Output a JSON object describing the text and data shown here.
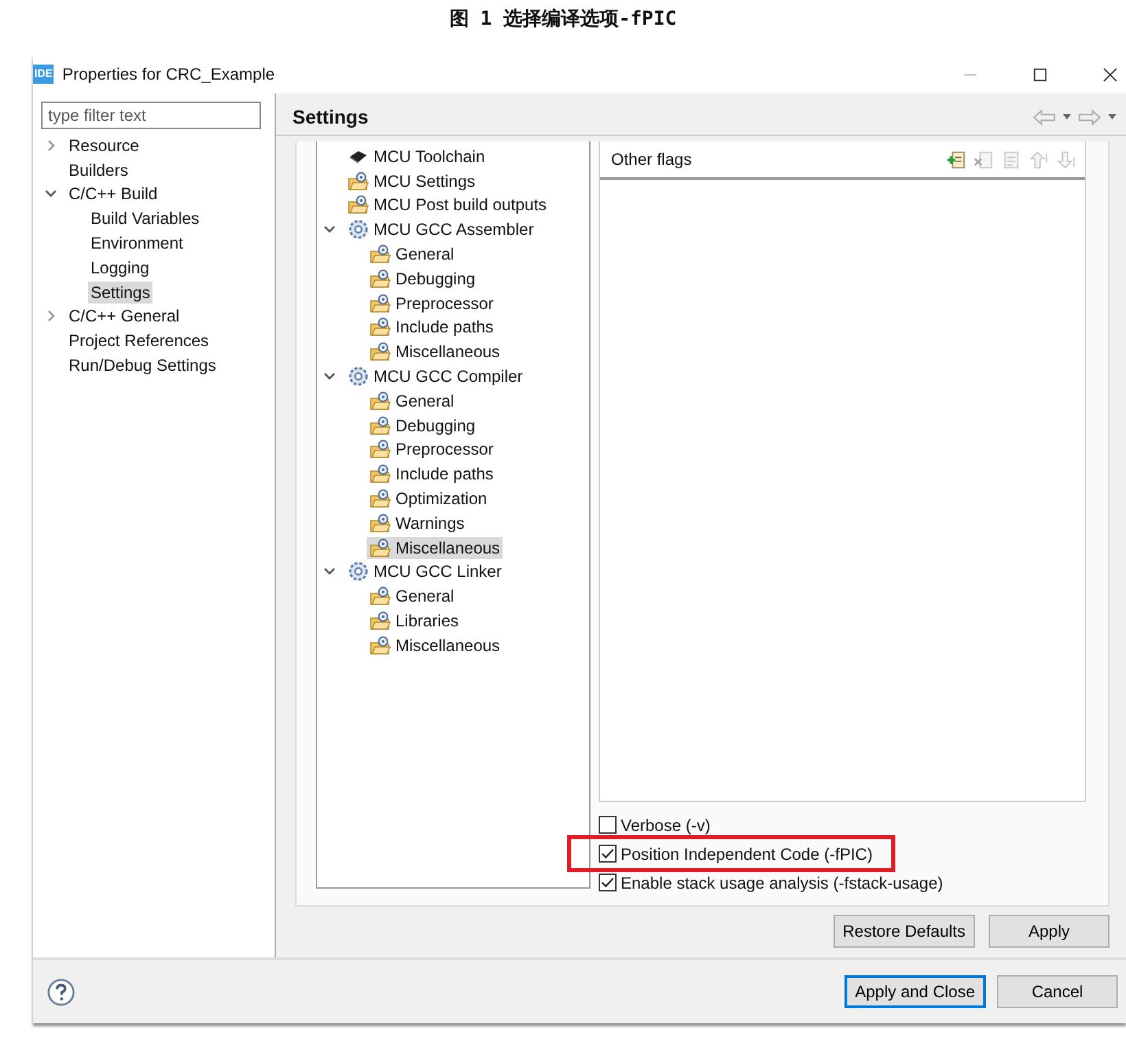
{
  "caption": "图 1 选择编译选项-fPIC",
  "window": {
    "app_badge": "IDE",
    "title": "Properties for CRC_Example"
  },
  "filter": {
    "placeholder": "type filter text"
  },
  "nav": [
    {
      "label": "Resource",
      "expanded": false,
      "selected": false
    },
    {
      "label": "Builders",
      "selected": false
    },
    {
      "label": "C/C++ Build",
      "expanded": true,
      "selected": false,
      "children": [
        {
          "label": "Build Variables",
          "selected": false
        },
        {
          "label": "Environment",
          "selected": false
        },
        {
          "label": "Logging",
          "selected": false
        },
        {
          "label": "Settings",
          "selected": true
        }
      ]
    },
    {
      "label": "C/C++ General",
      "expanded": false,
      "selected": false
    },
    {
      "label": "Project References",
      "selected": false
    },
    {
      "label": "Run/Debug Settings",
      "selected": false
    }
  ],
  "page_title": "Settings",
  "tool_tree": [
    {
      "label": "MCU Toolchain",
      "kind": "chip",
      "selected": false
    },
    {
      "label": "MCU Settings",
      "kind": "folder",
      "selected": false
    },
    {
      "label": "MCU Post build outputs",
      "kind": "folder",
      "selected": false
    },
    {
      "label": "MCU GCC Assembler",
      "kind": "tool",
      "expanded": true,
      "selected": false,
      "children": [
        {
          "label": "General",
          "kind": "folder",
          "selected": false
        },
        {
          "label": "Debugging",
          "kind": "folder",
          "selected": false
        },
        {
          "label": "Preprocessor",
          "kind": "folder",
          "selected": false
        },
        {
          "label": "Include paths",
          "kind": "folder",
          "selected": false
        },
        {
          "label": "Miscellaneous",
          "kind": "folder",
          "selected": false
        }
      ]
    },
    {
      "label": "MCU GCC Compiler",
      "kind": "tool",
      "expanded": true,
      "selected": false,
      "children": [
        {
          "label": "General",
          "kind": "folder",
          "selected": false
        },
        {
          "label": "Debugging",
          "kind": "folder",
          "selected": false
        },
        {
          "label": "Preprocessor",
          "kind": "folder",
          "selected": false
        },
        {
          "label": "Include paths",
          "kind": "folder",
          "selected": false
        },
        {
          "label": "Optimization",
          "kind": "folder",
          "selected": false
        },
        {
          "label": "Warnings",
          "kind": "folder",
          "selected": false
        },
        {
          "label": "Miscellaneous",
          "kind": "folder",
          "selected": true
        }
      ]
    },
    {
      "label": "MCU GCC Linker",
      "kind": "tool",
      "expanded": true,
      "selected": false,
      "children": [
        {
          "label": "General",
          "kind": "folder",
          "selected": false
        },
        {
          "label": "Libraries",
          "kind": "folder",
          "selected": false
        },
        {
          "label": "Miscellaneous",
          "kind": "folder",
          "selected": false
        }
      ]
    }
  ],
  "other_flags": {
    "label": "Other flags",
    "tools": [
      {
        "kind": "add",
        "disabled": false
      },
      {
        "kind": "delete",
        "disabled": true
      },
      {
        "kind": "edit",
        "disabled": true
      },
      {
        "kind": "up",
        "disabled": true
      },
      {
        "kind": "down",
        "disabled": true
      }
    ]
  },
  "options": [
    {
      "label": "Verbose (-v)",
      "checked": false,
      "highlighted": false
    },
    {
      "label": "Position Independent Code (-fPIC)",
      "checked": true,
      "highlighted": true
    },
    {
      "label": "Enable stack usage analysis (-fstack-usage)",
      "checked": true,
      "highlighted": false
    }
  ],
  "page_buttons": [
    "Restore Defaults",
    "Apply"
  ],
  "dialog_buttons": [
    {
      "label": "Apply and Close",
      "default": true
    },
    {
      "label": "Cancel",
      "default": false
    }
  ]
}
